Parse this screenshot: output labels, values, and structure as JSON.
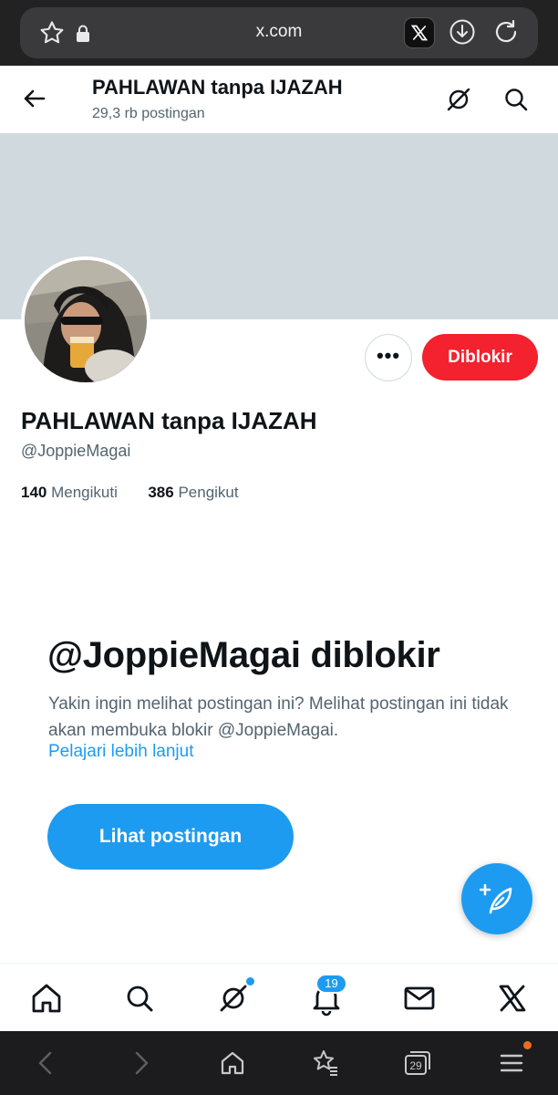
{
  "browser": {
    "url": "x.com",
    "tab_count": "29"
  },
  "header": {
    "title": "PAHLAWAN tanpa IJAZAH",
    "post_count": "29,3 rb postingan"
  },
  "profile": {
    "display_name": "PAHLAWAN tanpa IJAZAH",
    "handle": "@JoppieMagai",
    "following_count": "140",
    "following_label": "Mengikuti",
    "followers_count": "386",
    "followers_label": "Pengikut",
    "more_label": "•••",
    "blocked_button_label": "Diblokir"
  },
  "blocked_notice": {
    "title": "@JoppieMagai diblokir",
    "description": "Yakin ingin melihat postingan ini? Melihat postingan ini tidak akan membuka blokir @JoppieMagai.",
    "learn_more": "Pelajari lebih lanjut",
    "view_posts_button": "Lihat postingan"
  },
  "bottom_nav": {
    "items": [
      "home-icon",
      "search-icon",
      "grok-icon",
      "notifications-icon",
      "messages-icon",
      "x-icon"
    ],
    "notification_count": "19"
  },
  "colors": {
    "accent": "#1d9bf0",
    "blocked": "#f4212e",
    "banner": "#cfd9de"
  }
}
